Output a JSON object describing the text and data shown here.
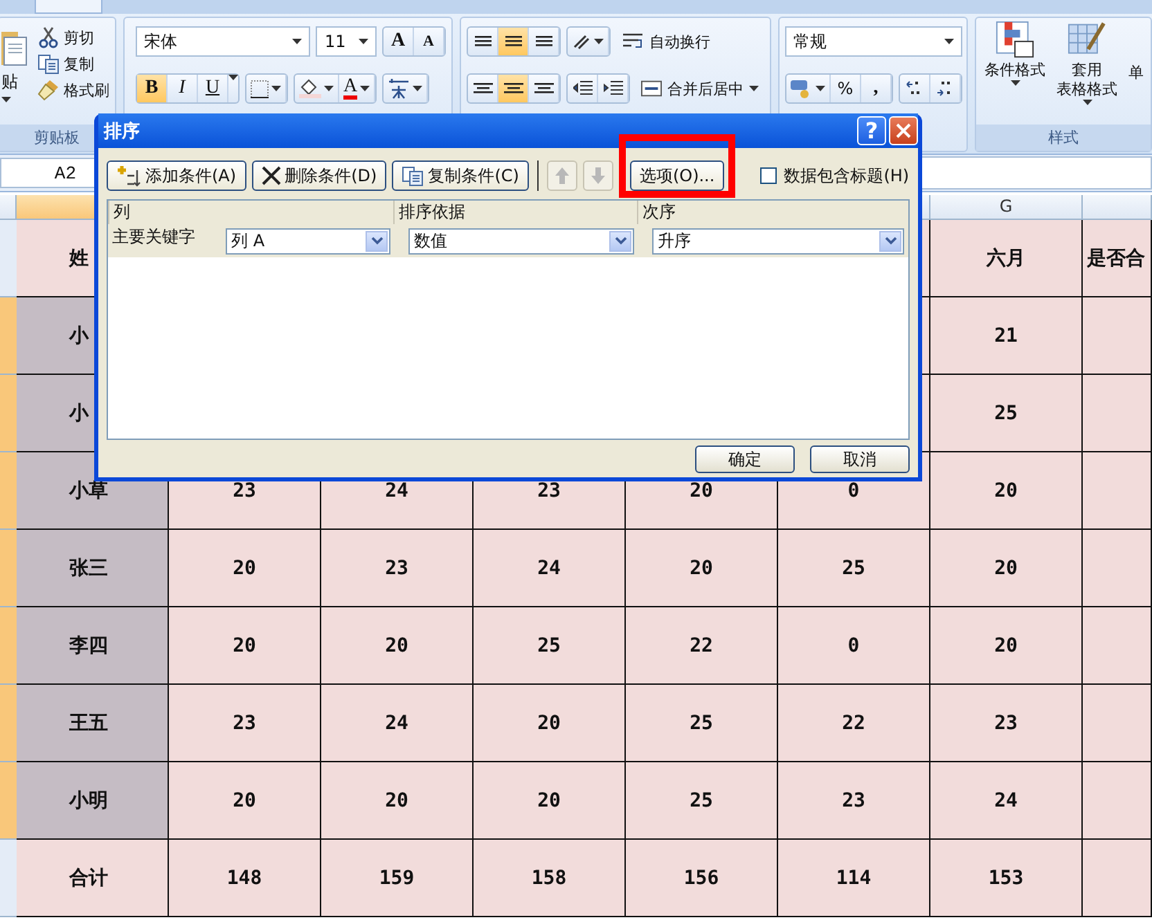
{
  "ribbon": {
    "clipboard": {
      "paste_label": "贴",
      "items": [
        {
          "kind": "cut",
          "label": "剪切"
        },
        {
          "kind": "copy",
          "label": "复制"
        },
        {
          "kind": "brush",
          "label": "格式刷"
        }
      ],
      "group_label": "剪贴板"
    },
    "font": {
      "name": "宋体",
      "size": "11",
      "grow": "A",
      "shrink": "A",
      "styles": [
        {
          "label": "B",
          "on": true
        },
        {
          "label": "I",
          "on": false
        },
        {
          "label": "U",
          "on": false
        }
      ],
      "font_color": "A"
    },
    "alignment": {
      "vertical": [
        {
          "selected": false
        },
        {
          "selected": true
        },
        {
          "selected": false
        }
      ],
      "horizontal": [
        {
          "selected": false
        },
        {
          "selected": true
        },
        {
          "selected": false
        }
      ],
      "wrap": "自动换行",
      "merge": "合并后居中"
    },
    "number": {
      "format": "常规",
      "percent": "%",
      "comma": ","
    },
    "styles": {
      "items": [
        {
          "kind": "conditional",
          "lines": [
            "条件格式"
          ]
        },
        {
          "kind": "table",
          "lines": [
            "套用",
            "表格格式"
          ]
        }
      ],
      "cut_item": "单",
      "group_label": "样式"
    }
  },
  "name_box": "A2",
  "sheet": {
    "columns": [
      {
        "selected": true
      },
      {},
      {},
      {},
      {},
      {
        "selected": false
      },
      {
        "label": "G",
        "selected": false
      },
      {
        "selected": false
      }
    ],
    "rows": [
      {
        "selected": false,
        "cells": [
          {
            "text": "姓"
          },
          {},
          {},
          {},
          {},
          {},
          {
            "text": "六月"
          },
          {
            "text": "是否合"
          }
        ]
      },
      {
        "selected": true,
        "cells": [
          {
            "text": "小"
          },
          {},
          {},
          {},
          {},
          {},
          {
            "text": "21"
          },
          {}
        ]
      },
      {
        "selected": true,
        "cells": [
          {
            "text": "小"
          },
          {},
          {},
          {},
          {},
          {},
          {
            "text": "25"
          },
          {}
        ]
      },
      {
        "selected": true,
        "cells": [
          {
            "text": "小草"
          },
          {
            "text": "23"
          },
          {
            "text": "24"
          },
          {
            "text": "23"
          },
          {
            "text": "20"
          },
          {
            "text": "0"
          },
          {
            "text": "20"
          },
          {}
        ]
      },
      {
        "selected": true,
        "cells": [
          {
            "text": "张三"
          },
          {
            "text": "20"
          },
          {
            "text": "23"
          },
          {
            "text": "24"
          },
          {
            "text": "20"
          },
          {
            "text": "25"
          },
          {
            "text": "20"
          },
          {}
        ]
      },
      {
        "selected": true,
        "cells": [
          {
            "text": "李四"
          },
          {
            "text": "20"
          },
          {
            "text": "20"
          },
          {
            "text": "25"
          },
          {
            "text": "22"
          },
          {
            "text": "0"
          },
          {
            "text": "20"
          },
          {}
        ]
      },
      {
        "selected": true,
        "cells": [
          {
            "text": "王五"
          },
          {
            "text": "23"
          },
          {
            "text": "24"
          },
          {
            "text": "20"
          },
          {
            "text": "25"
          },
          {
            "text": "22"
          },
          {
            "text": "23"
          },
          {}
        ]
      },
      {
        "selected": true,
        "cells": [
          {
            "text": "小明"
          },
          {
            "text": "20"
          },
          {
            "text": "20"
          },
          {
            "text": "20"
          },
          {
            "text": "25"
          },
          {
            "text": "23"
          },
          {
            "text": "24"
          },
          {}
        ]
      },
      {
        "selected": false,
        "cells": [
          {
            "text": "合计"
          },
          {
            "text": "148"
          },
          {
            "text": "159"
          },
          {
            "text": "158"
          },
          {
            "text": "156"
          },
          {
            "text": "114"
          },
          {
            "text": "153"
          },
          {}
        ]
      }
    ]
  },
  "dialog": {
    "title": "排序",
    "help": "?",
    "toolbar": [
      {
        "kind": "add",
        "label": "添加条件(A)"
      },
      {
        "kind": "delete",
        "label": "删除条件(D)"
      },
      {
        "kind": "copy",
        "label": "复制条件(C)"
      },
      {
        "kind": "up",
        "disabled": true
      },
      {
        "kind": "down",
        "disabled": true
      },
      {
        "kind": "options",
        "label": "选项(O)...",
        "highlighted": true
      }
    ],
    "header_checkbox": {
      "label": "数据包含标题(H)",
      "checked": false
    },
    "columns": [
      "列",
      "排序依据",
      "次序"
    ],
    "levels": [
      {
        "label": "主要关键字",
        "column": "列 A",
        "sort_on": "数值",
        "order": "升序"
      }
    ],
    "buttons": [
      "确定",
      "取消"
    ]
  }
}
